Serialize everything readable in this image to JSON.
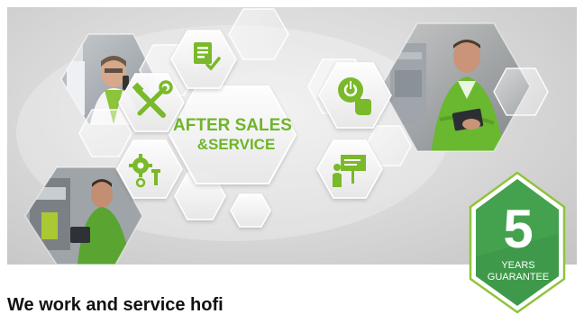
{
  "banner": {
    "title_line1": "AFTER SALES",
    "title_line2": "&SERVICE",
    "hex_icons": [
      "checklist-icon",
      "tools-icon",
      "touch-support-icon",
      "gears-icon",
      "presentation-icon"
    ],
    "photos": [
      "technician-on-phone-photo",
      "technician-with-tablet-photo",
      "technician-at-machine-photo"
    ]
  },
  "badge": {
    "number": "5",
    "line1": "YEARS",
    "line2": "GUARANTEE"
  },
  "heading": "We work and service hofi",
  "colors": {
    "brand_green": "#7ab929",
    "badge_fill": "#3e9a4a",
    "badge_outline": "#8fc43a",
    "title_green": "#6fb52a"
  }
}
